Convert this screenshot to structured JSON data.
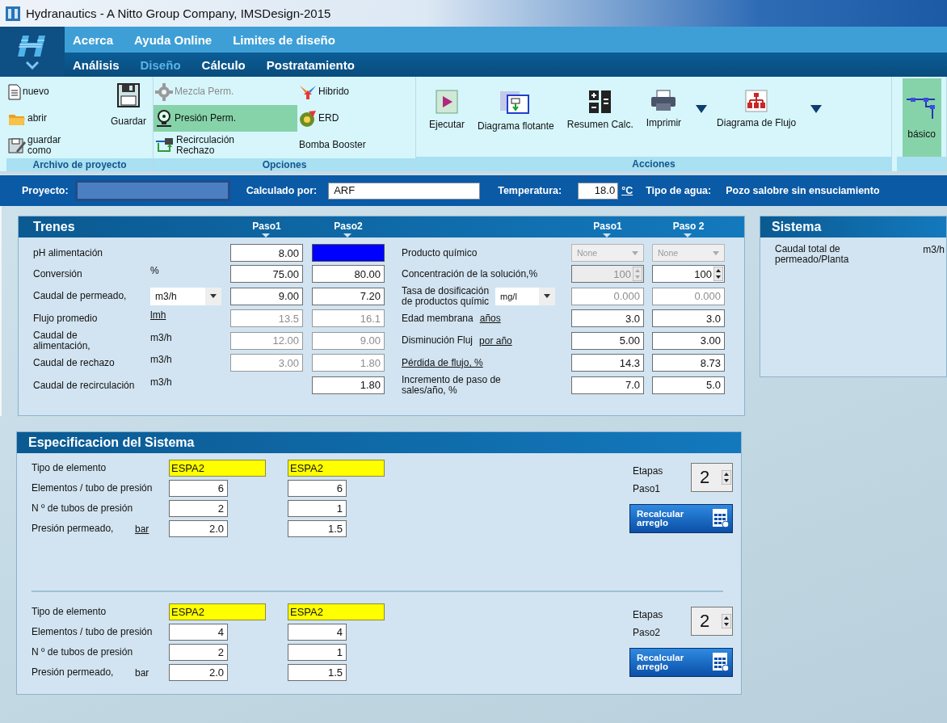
{
  "window": {
    "title": "Hydranautics - A Nitto Group Company, IMSDesign-2015"
  },
  "menu": {
    "top_items": [
      "Acerca",
      "Ayuda Online",
      "Limites de diseño"
    ],
    "tabs": [
      {
        "label": "Análisis",
        "selected": false
      },
      {
        "label": "Diseño",
        "selected": true
      },
      {
        "label": "Cálculo",
        "selected": false
      },
      {
        "label": "Postratamiento",
        "selected": false
      }
    ]
  },
  "ribbon": {
    "groups": [
      {
        "label": "Archivo de proyecto",
        "items": [
          {
            "label": "nuevo",
            "kind": "small",
            "selected": false
          },
          {
            "label": "abrir",
            "kind": "small",
            "selected": false
          },
          {
            "label": "guardar\ncomo",
            "kind": "small",
            "selected": false
          },
          {
            "label": "Guardar",
            "kind": "large",
            "selected": false
          }
        ]
      },
      {
        "label": "Opciones",
        "items": [
          {
            "label": "Mezcla Perm.",
            "kind": "small",
            "selected": false,
            "disabled": true
          },
          {
            "label": "Presión Perm.",
            "kind": "small",
            "selected": true,
            "disabled": false
          },
          {
            "label": "Recirculación\nRechazo",
            "kind": "small",
            "selected": false,
            "disabled": false
          },
          {
            "label": "Hibrido",
            "kind": "small",
            "selected": false,
            "disabled": false
          },
          {
            "label": "ERD",
            "kind": "small",
            "selected": false,
            "disabled": false
          },
          {
            "label": "Bomba Booster",
            "kind": "text",
            "selected": false,
            "disabled": false
          }
        ]
      },
      {
        "label": "Acciones",
        "items": [
          {
            "label": "Ejecutar",
            "kind": "large",
            "selected": false
          },
          {
            "label": "Diagrama flotante",
            "kind": "large",
            "selected": false
          },
          {
            "label": "Resumen Calc.",
            "kind": "large",
            "selected": false
          },
          {
            "label": "Imprimir",
            "kind": "large-dropdown",
            "selected": false
          },
          {
            "label": "Diagrama de Flujo",
            "kind": "large-dropdown",
            "selected": false
          }
        ]
      },
      {
        "items": [
          {
            "label": "básico",
            "kind": "large",
            "selected": true
          }
        ]
      }
    ]
  },
  "project_bar": {
    "project_label": "Proyecto:",
    "calculated_by_label": "Calculado por:",
    "calculated_by": "ARF",
    "temperature_label": "Temperatura:",
    "temperature": "18.0",
    "temperature_unit": "°C",
    "water_type_label": "Tipo de agua:",
    "water_type": "Pozo salobre sin ensuciamiento"
  },
  "trenes": {
    "title": "Trenes",
    "columns": [
      "Paso1",
      "Paso2"
    ],
    "chem_columns": [
      "Paso1",
      "Paso 2"
    ],
    "rows": [
      {
        "label": "pH alimentación",
        "cells": [
          {
            "value": "8.00",
            "disabled": false,
            "selected": false
          },
          {
            "disabled": false,
            "selected": true
          }
        ]
      },
      {
        "label": "Conversión",
        "unit": {
          "text": "%",
          "kind": "text"
        },
        "cells": [
          {
            "value": "75.00",
            "disabled": false,
            "selected": false
          },
          {
            "value": "80.00",
            "disabled": false,
            "selected": false
          }
        ]
      },
      {
        "label": "Caudal de permeado,",
        "unit": {
          "text": "m3/h",
          "kind": "select"
        },
        "cells": [
          {
            "value": "9.00",
            "disabled": false,
            "selected": false
          },
          {
            "value": "7.20",
            "disabled": false,
            "selected": false
          }
        ]
      },
      {
        "label": "Flujo promedio",
        "unit": {
          "text": "lmh",
          "kind": "link"
        },
        "cells": [
          {
            "value": "13.5",
            "disabled": true,
            "selected": false
          },
          {
            "value": "16.1",
            "disabled": true,
            "selected": false
          }
        ]
      },
      {
        "label": "Caudal de\nalimentación,",
        "unit": {
          "text": "m3/h",
          "kind": "text"
        },
        "cells": [
          {
            "value": "12.00",
            "disabled": true,
            "selected": false
          },
          {
            "value": "9.00",
            "disabled": true,
            "selected": false
          }
        ]
      },
      {
        "label": "Caudal de rechazo",
        "unit": {
          "text": "m3/h",
          "kind": "text"
        },
        "cells": [
          {
            "value": "3.00",
            "disabled": true,
            "selected": false
          },
          {
            "value": "1.80",
            "disabled": true,
            "selected": false
          }
        ]
      },
      {
        "label": "Caudal de recirculación",
        "unit": {
          "text": "m3/h",
          "kind": "text"
        },
        "cells": [
          null,
          {
            "value": "1.80",
            "disabled": false,
            "selected": false
          }
        ]
      }
    ],
    "chem_rows": [
      {
        "label": "Producto químico",
        "link": false,
        "cells": [
          {
            "kind": "select",
            "value": "None",
            "disabled": true
          },
          {
            "kind": "select",
            "value": "None",
            "disabled": true
          }
        ]
      },
      {
        "label": "Concentración de la solución,%",
        "link": false,
        "cells": [
          {
            "kind": "spin",
            "value": "100",
            "disabled": true
          },
          {
            "kind": "spin",
            "value": "100",
            "disabled": false
          }
        ]
      },
      {
        "label": "Tasa de dosificación\nde productos químic",
        "link": false,
        "unit": {
          "text": "mg/l",
          "kind": "select"
        },
        "cells": [
          {
            "kind": "text",
            "value": "0.000",
            "disabled": true
          },
          {
            "kind": "text",
            "value": "0.000",
            "disabled": true
          }
        ]
      },
      {
        "label": "Edad membrana",
        "link": false,
        "unit": {
          "text": "años",
          "kind": "link"
        },
        "cells": [
          {
            "kind": "text",
            "value": "3.0",
            "disabled": false
          },
          {
            "kind": "text",
            "value": "3.0",
            "disabled": false
          }
        ]
      },
      {
        "label": "Disminución Fluj",
        "link": false,
        "unit": {
          "text": "por año",
          "kind": "link"
        },
        "cells": [
          {
            "kind": "text",
            "value": "5.00",
            "disabled": false
          },
          {
            "kind": "text",
            "value": "3.00",
            "disabled": false
          }
        ]
      },
      {
        "label": "Pérdida de flujo, %",
        "link": true,
        "cells": [
          {
            "kind": "text",
            "value": "14.3",
            "disabled": false
          },
          {
            "kind": "text",
            "value": "8.73",
            "disabled": false
          }
        ]
      },
      {
        "label": "Incremento de paso de\nsales/año, %",
        "link": false,
        "cells": [
          {
            "kind": "text",
            "value": "7.0",
            "disabled": false
          },
          {
            "kind": "text",
            "value": "5.0",
            "disabled": false
          }
        ]
      }
    ]
  },
  "sistema": {
    "title": "Sistema",
    "rows": [
      {
        "label": "Caudal total de\npermeado/Planta",
        "unit": "m3/h"
      }
    ]
  },
  "spec": {
    "title": "Especificacion del Sistema",
    "passes": [
      {
        "rows": [
          {
            "label": "Tipo de elemento",
            "kind": "type",
            "cells": [
              "ESPA2",
              "ESPA2"
            ]
          },
          {
            "label": "Elementos / tubo de presión",
            "kind": "number",
            "cells": [
              "6",
              "6"
            ]
          },
          {
            "label": "N º de tubos de presión",
            "kind": "number",
            "cells": [
              "2",
              "1"
            ]
          },
          {
            "label": "Presión permeado,",
            "kind": "number",
            "unit": {
              "text": "bar",
              "kind": "link"
            },
            "cells": [
              "2.0",
              "1.5"
            ]
          }
        ],
        "stages_label": "Etapas",
        "pass_label": "Paso1",
        "stages": "2",
        "button": "Recalcular\narreglo"
      },
      {
        "rows": [
          {
            "label": "Tipo de elemento",
            "kind": "type",
            "cells": [
              "ESPA2",
              "ESPA2"
            ]
          },
          {
            "label": "Elementos / tubo de presión",
            "kind": "number",
            "cells": [
              "4",
              "4"
            ]
          },
          {
            "label": "N º de tubos de presión",
            "kind": "number",
            "cells": [
              "2",
              "1"
            ]
          },
          {
            "label": "Presión permeado,",
            "kind": "number",
            "unit": {
              "text": "bar",
              "kind": "text"
            },
            "cells": [
              "2.0",
              "1.5"
            ]
          }
        ],
        "stages_label": "Etapas",
        "pass_label": "Paso2",
        "stages": "2",
        "button": "Recalcular\narreglo"
      }
    ]
  }
}
